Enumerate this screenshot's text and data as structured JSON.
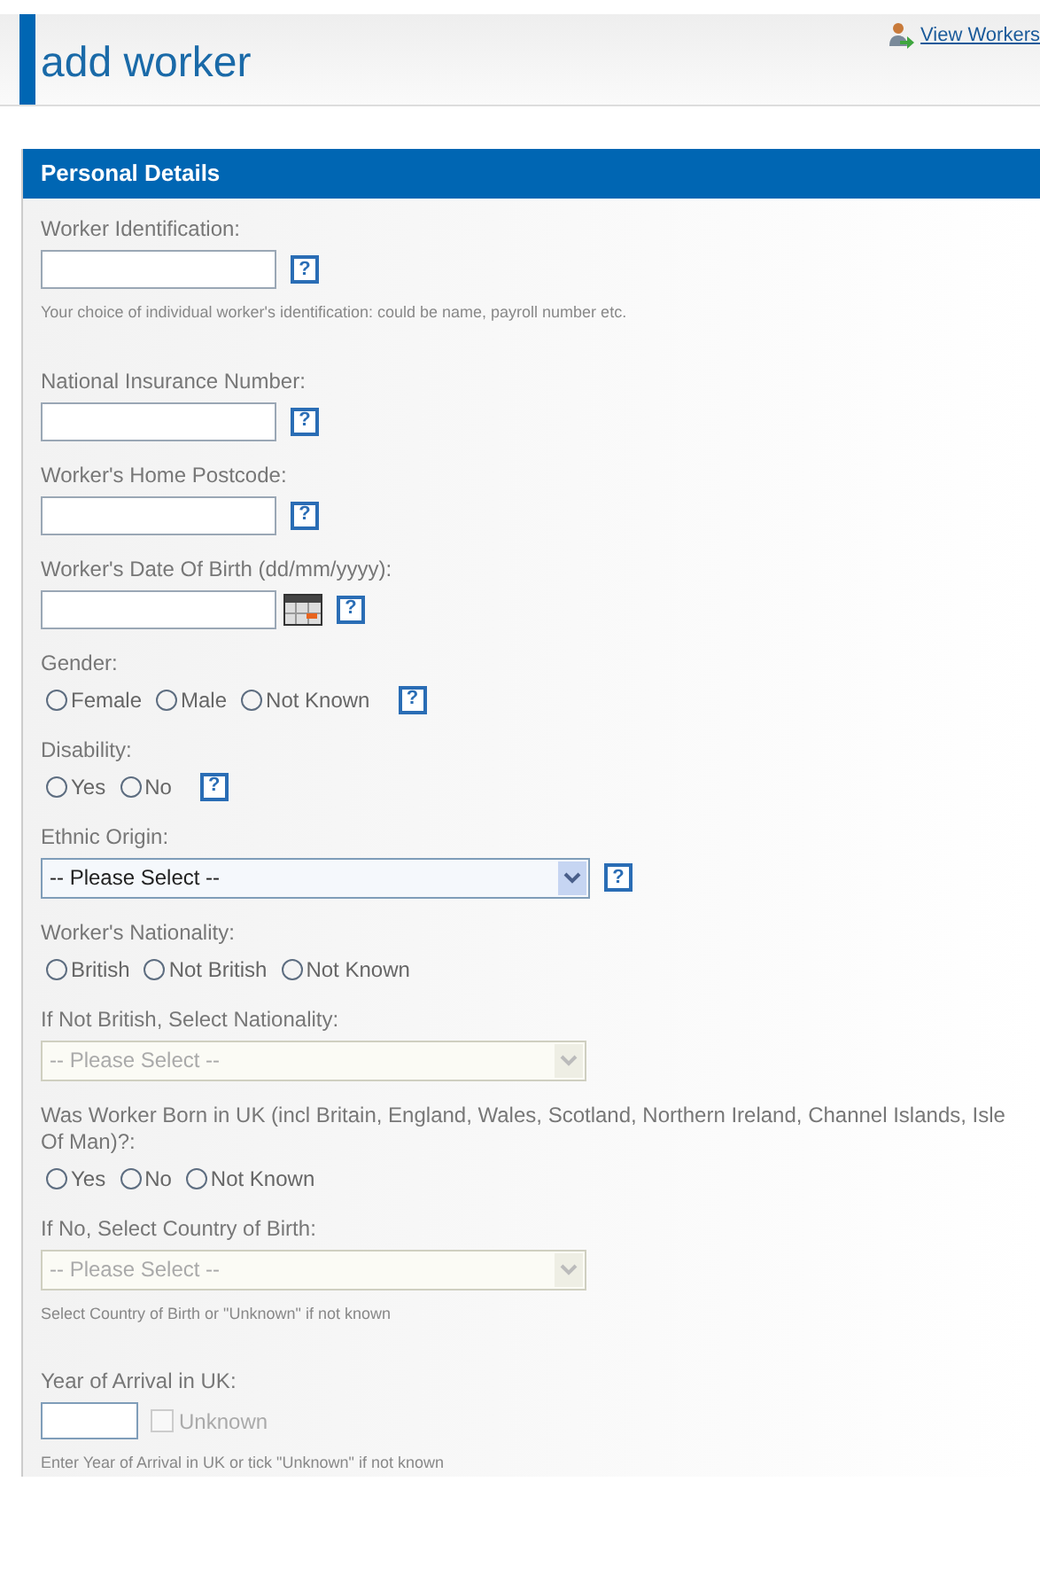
{
  "page": {
    "title": "add worker",
    "link": "View Workers"
  },
  "panel": {
    "title": "Personal Details",
    "fields": [
      {
        "kind": "text",
        "label": "Worker Identification:",
        "help": "?",
        "hint": "Your choice of individual worker's identification: could be name, payroll number etc."
      },
      {
        "kind": "text",
        "label": "National Insurance Number:",
        "help": "?"
      },
      {
        "kind": "text",
        "label": "Worker's Home Postcode:",
        "help": "?"
      },
      {
        "kind": "date",
        "label": "Worker's Date Of Birth (dd/mm/yyyy):",
        "help": "?"
      },
      {
        "kind": "radio",
        "label": "Gender:",
        "help": "?",
        "options": [
          {
            "label": "Female",
            "selected": false
          },
          {
            "label": "Male",
            "selected": false
          },
          {
            "label": "Not Known",
            "selected": false
          }
        ]
      },
      {
        "kind": "radio",
        "label": "Disability:",
        "help": "?",
        "options": [
          {
            "label": "Yes",
            "selected": false
          },
          {
            "label": "No",
            "selected": false
          }
        ]
      },
      {
        "kind": "select",
        "label": "Ethnic Origin:",
        "value": "-- Please Select --",
        "disabled": false,
        "help": "?"
      },
      {
        "kind": "radio",
        "label": "Worker's Nationality:",
        "options": [
          {
            "label": "British",
            "selected": false
          },
          {
            "label": "Not British",
            "selected": false
          },
          {
            "label": "Not Known",
            "selected": false
          }
        ]
      },
      {
        "kind": "select",
        "label": "If Not British, Select Nationality:",
        "value": "-- Please Select --",
        "disabled": true
      },
      {
        "kind": "radio",
        "label": "Was Worker Born in UK (incl Britain, England, Wales, Scotland, Northern Ireland, Channel Islands, Isle Of Man)?:",
        "options": [
          {
            "label": "Yes",
            "selected": false
          },
          {
            "label": "No",
            "selected": false
          },
          {
            "label": "Not Known",
            "selected": false
          }
        ]
      },
      {
        "kind": "select",
        "label": "If No, Select Country of Birth:",
        "value": "-- Please Select --",
        "disabled": true,
        "hint": "Select Country of Birth or \"Unknown\" if not known"
      },
      {
        "kind": "year",
        "label": "Year of Arrival in UK:",
        "checkbox": {
          "label": "Unknown",
          "checked": false,
          "disabled": true
        },
        "hint": "Enter Year of Arrival in UK or tick \"Unknown\" if not known"
      }
    ]
  }
}
